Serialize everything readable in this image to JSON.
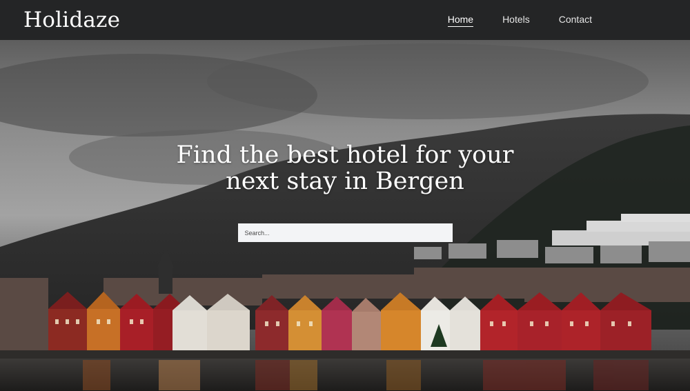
{
  "brand": {
    "name": "Holidaze"
  },
  "nav": {
    "items": [
      {
        "label": "Home",
        "active": true
      },
      {
        "label": "Hotels",
        "active": false
      },
      {
        "label": "Contact",
        "active": false
      }
    ]
  },
  "hero": {
    "headline": "Find the best hotel for your next stay in Bergen",
    "search": {
      "placeholder": "Search...",
      "value": ""
    }
  },
  "colors": {
    "nav_background": "#242526",
    "search_background": "#f3f4f6",
    "text": "#ffffff"
  }
}
